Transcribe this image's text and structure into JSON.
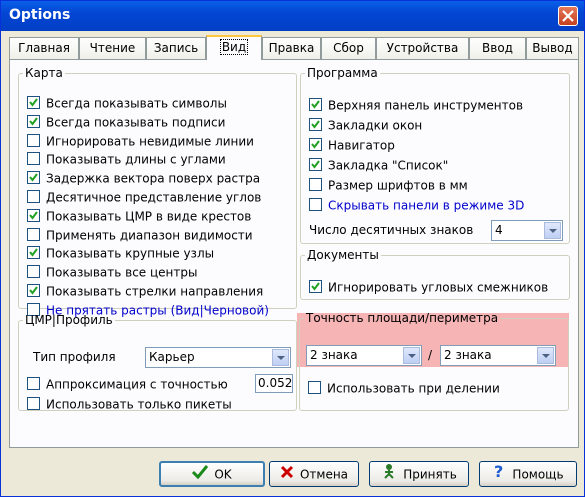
{
  "window": {
    "title": "Options"
  },
  "tabs": [
    "Главная",
    "Чтение",
    "Запись",
    "Вид",
    "Правка",
    "Сбор",
    "Устройства",
    "Ввод",
    "Вывод"
  ],
  "map_group": {
    "title": "Карта",
    "items": [
      {
        "label": "Всегда показывать символы",
        "checked": true,
        "color": "#000000"
      },
      {
        "label": "Всегда показывать подписи",
        "checked": true,
        "color": "#000000"
      },
      {
        "label": "Игнорировать невидимые линии",
        "checked": false,
        "color": "#000000"
      },
      {
        "label": "Показывать длины с углами",
        "checked": false,
        "color": "#000000"
      },
      {
        "label": "Задержка вектора поверх растра",
        "checked": true,
        "color": "#000000"
      },
      {
        "label": "Десятичное представление углов",
        "checked": false,
        "color": "#000000"
      },
      {
        "label": "Показывать ЦМР в виде крестов",
        "checked": true,
        "color": "#000000"
      },
      {
        "label": "Применять диапазон видимости",
        "checked": false,
        "color": "#000000"
      },
      {
        "label": "Показывать крупные узлы",
        "checked": true,
        "color": "#000000"
      },
      {
        "label": "Показывать все центры",
        "checked": false,
        "color": "#000000"
      },
      {
        "label": "Показывать стрелки направления",
        "checked": true,
        "color": "#000000"
      },
      {
        "label": "Не прятать растры (Вид|Черновой)",
        "checked": false,
        "color": "#0000cc"
      }
    ]
  },
  "program_group": {
    "title": "Программа",
    "items": [
      {
        "label": "Верхняя панель инструментов",
        "checked": true,
        "color": "#000000"
      },
      {
        "label": "Закладки окон",
        "checked": true,
        "color": "#000000"
      },
      {
        "label": "Навигатор",
        "checked": true,
        "color": "#000000"
      },
      {
        "label": "Закладка \"Список\"",
        "checked": true,
        "color": "#000000"
      },
      {
        "label": "Размер шрифтов в мм",
        "checked": false,
        "color": "#000000"
      },
      {
        "label": "Скрывать панели в режиме 3D",
        "checked": false,
        "color": "#0000cc"
      }
    ],
    "decimals_label": "Число десятичных знаков",
    "decimals_value": "4"
  },
  "documents_group": {
    "title": "Документы",
    "items": [
      {
        "label": "Игнорировать угловых смежников",
        "checked": true,
        "color": "#000000"
      }
    ]
  },
  "dtm_group": {
    "title": "ЦМР|Профиль",
    "profile_type_label": "Тип профиля",
    "profile_type_value": "Карьер",
    "approx_label": "Аппроксимация с точностью",
    "approx_checked": false,
    "approx_value": "0.052",
    "pickets_label": "Использовать только пикеты",
    "pickets_checked": false
  },
  "precision_group": {
    "title": "Точность площади/периметра",
    "area_value": "2 знака",
    "separator": "/",
    "perimeter_value": "2 знака",
    "use_in_division_label": "Использовать при делении",
    "use_in_division_checked": false
  },
  "buttons": {
    "ok": "OK",
    "cancel": "Отмена",
    "apply": "Принять",
    "help": "Помощь"
  },
  "colors": {
    "title_bar": "#0346d3",
    "dialog_bg": "#ece9d8",
    "highlight": "#f07878"
  }
}
